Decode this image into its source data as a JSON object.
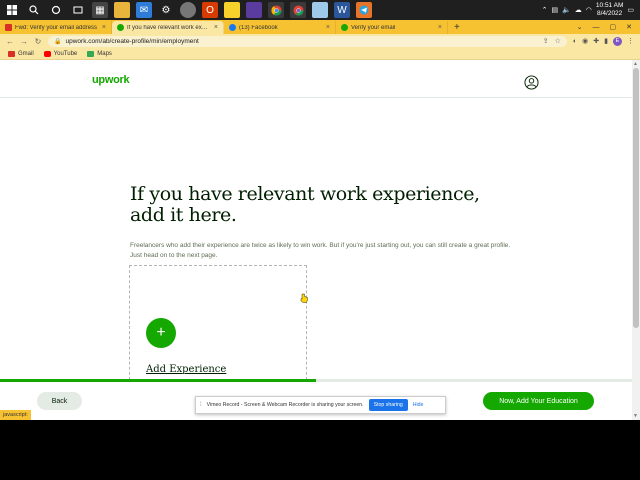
{
  "taskbar": {
    "time": "10:51 AM",
    "date": "8/4/2022"
  },
  "tabs": [
    {
      "label": "Fwd: Verify your email address",
      "color": "#d93025"
    },
    {
      "label": "If you have relevant work experie",
      "color": "#14a800",
      "active": true
    },
    {
      "label": "(13) Facebook",
      "color": "#1877f2"
    },
    {
      "label": "Verify your email",
      "color": "#14a800"
    }
  ],
  "address": {
    "url": "upwork.com/ab/create-profile/min/employment"
  },
  "bookmarks": [
    {
      "label": "Gmail",
      "color": "#d93025"
    },
    {
      "label": "YouTube",
      "color": "#ff0000"
    },
    {
      "label": "Maps",
      "color": "#34a853"
    }
  ],
  "header": {
    "logo": "upwork"
  },
  "main": {
    "title_line1": "If you have relevant work experience,",
    "title_line2": "add it here.",
    "subtitle_line1": "Freelancers who add their experience are twice as likely to win work. But if you're just starting out, you can still create a great profile.",
    "subtitle_line2": "Just head on to the next page.",
    "add_label": "Add Experience"
  },
  "progress": {
    "percent": 50
  },
  "footer": {
    "back_label": "Back",
    "next_label": "Now, Add Your Education"
  },
  "share": {
    "text": "Vimeo Record - Screen & Webcam Recorder is sharing your screen.",
    "stop_label": "Stop sharing",
    "hide_label": "Hide"
  },
  "status": {
    "text": "javascript:"
  },
  "colors": {
    "brand": "#14a800",
    "chrome": "#f6c232"
  }
}
